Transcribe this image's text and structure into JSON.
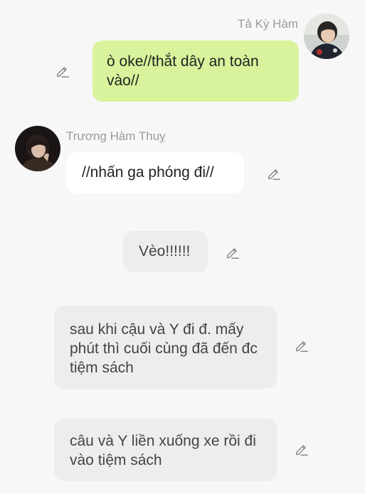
{
  "messages": [
    {
      "sender": "Tả Kỳ Hàm",
      "text": "ò oke//thắt dây an toàn vào//",
      "style": "green",
      "icon": "pencil-icon"
    },
    {
      "sender": "Trương Hàm Thuỵ",
      "text": "//nhấn ga phóng đi//",
      "style": "white",
      "icon": "pencil-icon"
    },
    {
      "text": "Vèo!!!!!!",
      "style": "gray",
      "icon": "pencil-icon"
    },
    {
      "text": "sau khi cậu và Y đi đ. mấy phút thì cuối cùng đã đến đc tiệm sách",
      "style": "gray",
      "icon": "pencil-icon"
    },
    {
      "text": "câu và Y liền xuống xe rồi đi vào tiệm sách",
      "style": "gray",
      "icon": "pencil-icon"
    }
  ],
  "colors": {
    "background": "#f7f7f7",
    "green_bubble": "#d8f39c",
    "white_bubble": "#ffffff",
    "gray_bubble": "#ededed",
    "name_text": "#9a9a9a",
    "icon": "#8a8a8a"
  }
}
